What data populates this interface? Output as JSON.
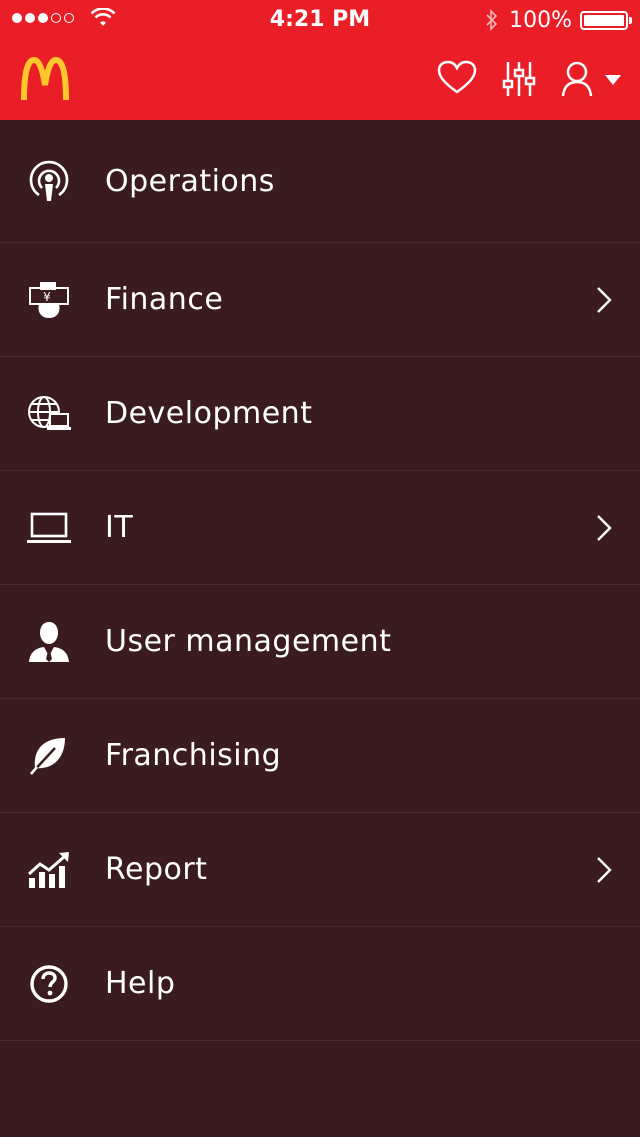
{
  "status_bar": {
    "time": "4:21 PM",
    "battery": "100%"
  },
  "header": {
    "logo": "McDonald's golden arches logo",
    "icons": [
      "heart-icon",
      "sliders-icon",
      "user-icon",
      "caret-down-icon"
    ]
  },
  "menu": {
    "items": [
      {
        "label": "Operations",
        "icon": "podcast-icon",
        "has_arrow": false
      },
      {
        "label": "Finance",
        "icon": "yen-hand-icon",
        "has_arrow": true
      },
      {
        "label": "Development",
        "icon": "globe-laptop-icon",
        "has_arrow": false
      },
      {
        "label": "IT",
        "icon": "laptop-icon",
        "has_arrow": true
      },
      {
        "label": "User management",
        "icon": "user-tie-icon",
        "has_arrow": false
      },
      {
        "label": "Franchising",
        "icon": "leaf-icon",
        "has_arrow": false
      },
      {
        "label": "Report",
        "icon": "bar-chart-up-icon",
        "has_arrow": true
      },
      {
        "label": "Help",
        "icon": "question-circle-icon",
        "has_arrow": false
      }
    ]
  },
  "colors": {
    "header_red": "#ea1e27",
    "background": "#3a1c1e",
    "logo_yellow": "#ffc72c"
  }
}
